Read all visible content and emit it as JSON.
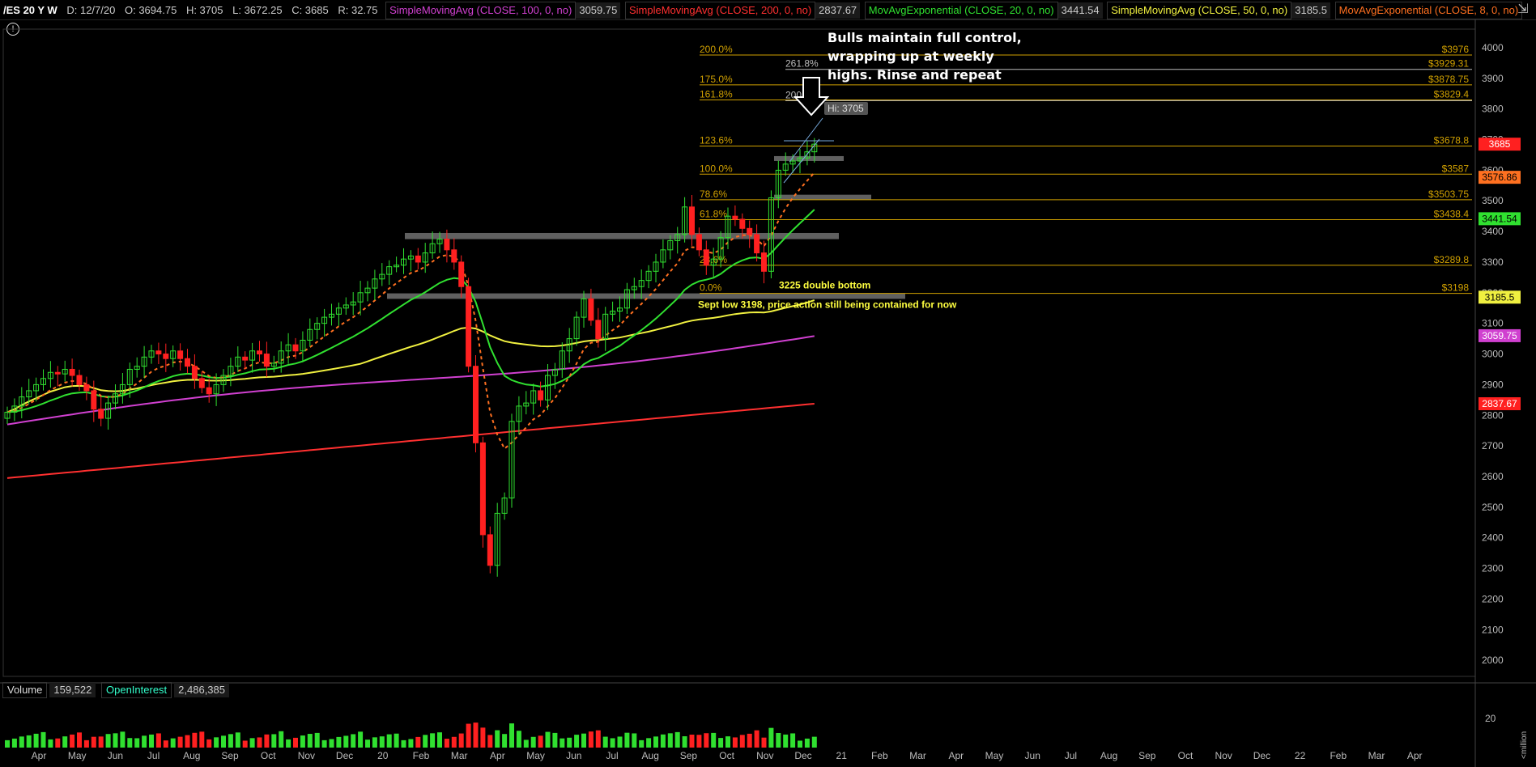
{
  "header": {
    "symbol": "/ES 20 Y W",
    "ohlc": [
      "D: 12/7/20",
      "O: 3694.75",
      "H: 3705",
      "L: 3672.25",
      "C: 3685",
      "R: 32.75"
    ],
    "studies": [
      {
        "label": "SimpleMovingAvg (CLOSE, 100, 0, no)",
        "value": "3059.75",
        "color": "#d040d0"
      },
      {
        "label": "SimpleMovingAvg (CLOSE, 200, 0, no)",
        "value": "2837.67",
        "color": "#ff3030"
      },
      {
        "label": "MovAvgExponential (CLOSE, 20, 0, no)",
        "value": "3441.54",
        "color": "#30e030"
      },
      {
        "label": "SimpleMovingAvg (CLOSE, 50, 0, no)",
        "value": "3185.5",
        "color": "#f0f040"
      },
      {
        "label": "MovAvgExponential (CLOSE, 8, 0, no)",
        "value": "",
        "color": "#ff7020"
      }
    ]
  },
  "icons": {
    "info": "info-icon",
    "collapse": "collapse-icon"
  },
  "volume_header": {
    "volume_label": "Volume",
    "volume_value": "159,522",
    "oi_label": "OpenInterest",
    "oi_value": "2,486,385"
  },
  "colors": {
    "up": "#30e030",
    "down": "#ff2020",
    "fib": "#d0a000",
    "sma50": "#f0f040",
    "sma100": "#d040d0",
    "sma200": "#ff3030",
    "ema20": "#30e030",
    "ema8": "#ff7020",
    "zone": "#808080",
    "annotation": "#ffffff",
    "note": "#ffff40"
  },
  "chart_data": {
    "type": "candlestick",
    "ylim": [
      1900,
      4050
    ],
    "yticks": [
      2000,
      2100,
      2200,
      2300,
      2400,
      2500,
      2600,
      2700,
      2800,
      2900,
      3000,
      3100,
      3200,
      3300,
      3400,
      3500,
      3600,
      3700,
      3800,
      3900,
      4000
    ],
    "xaxis_labels": [
      "Apr",
      "May",
      "Jun",
      "Jul",
      "Aug",
      "Sep",
      "Oct",
      "Nov",
      "Dec",
      "20",
      "Feb",
      "Mar",
      "Apr",
      "May",
      "Jun",
      "Jul",
      "Aug",
      "Sep",
      "Oct",
      "Nov",
      "Dec",
      "21",
      "Feb",
      "Mar",
      "Apr",
      "May",
      "Jun",
      "Jul",
      "Aug",
      "Sep",
      "Oct",
      "Nov",
      "Dec",
      "22",
      "Feb",
      "Mar",
      "Apr"
    ],
    "first_week_index": 0,
    "weekly_closes": [
      2810,
      2830,
      2860,
      2880,
      2900,
      2920,
      2940,
      2935,
      2950,
      2930,
      2900,
      2880,
      2820,
      2790,
      2840,
      2870,
      2900,
      2950,
      2960,
      2990,
      3010,
      3000,
      2985,
      3010,
      2985,
      2960,
      2920,
      2890,
      2870,
      2900,
      2930,
      2960,
      2990,
      2980,
      3010,
      3000,
      2960,
      2970,
      3010,
      3030,
      3010,
      3045,
      3080,
      3100,
      3120,
      3130,
      3150,
      3160,
      3170,
      3200,
      3215,
      3245,
      3260,
      3285,
      3290,
      3310,
      3320,
      3300,
      3330,
      3360,
      3375,
      3340,
      3300,
      3220,
      2960,
      2710,
      2410,
      2310,
      2480,
      2530,
      2780,
      2830,
      2840,
      2880,
      2850,
      2930,
      2950,
      3010,
      3050,
      3120,
      3180,
      3110,
      3050,
      3130,
      3140,
      3150,
      3210,
      3220,
      3240,
      3270,
      3300,
      3340,
      3370,
      3390,
      3480,
      3390,
      3340,
      3290,
      3310,
      3380,
      3450,
      3440,
      3410,
      3390,
      3330,
      3270,
      3510,
      3600,
      3620,
      3630,
      3640,
      3660,
      3685
    ],
    "annotations": [
      {
        "text": "Bulls maintain full control,",
        "kind": "headline"
      },
      {
        "text": "wrapping up at weekly",
        "kind": "headline"
      },
      {
        "text": "highs. Rinse and repeat",
        "kind": "headline"
      },
      {
        "text": "Hi: 3705",
        "kind": "tag"
      },
      {
        "text": "3225 double bottom",
        "kind": "note"
      },
      {
        "text": "Sept low 3198, price action still being contained for now",
        "kind": "note"
      }
    ],
    "fib_levels": [
      {
        "pct": "200.0%",
        "value": 3976,
        "label": "$3976"
      },
      {
        "pct": "261.8%",
        "value": 3929.31,
        "label": "$3929.31"
      },
      {
        "pct": "175.0%",
        "value": 3878.75,
        "label": "$3878.75"
      },
      {
        "pct": "161.8%",
        "value": 3829.4,
        "label": "$3829.4"
      },
      {
        "pct": "200.0%",
        "value": 3827,
        "label": ""
      },
      {
        "pct": "123.6%",
        "value": 3678.8,
        "label": "$3678.8"
      },
      {
        "pct": "100.0%",
        "value": 3587,
        "label": "$3587"
      },
      {
        "pct": "78.6%",
        "value": 3503.75,
        "label": "$3503.75"
      },
      {
        "pct": "61.8%",
        "value": 3438.4,
        "label": "$3438.4"
      },
      {
        "pct": "23.6%",
        "value": 3289.8,
        "label": "$3289.8"
      },
      {
        "pct": "0.0%",
        "value": 3198,
        "label": "$3198"
      }
    ],
    "price_tags": [
      {
        "value": 3685,
        "label": "3685",
        "bg": "#ff2020",
        "fg": "#ffffff"
      },
      {
        "value": 3576.86,
        "label": "3576.86",
        "bg": "#ff7020",
        "fg": "#000000"
      },
      {
        "value": 3441.54,
        "label": "3441.54",
        "bg": "#30e030",
        "fg": "#000000"
      },
      {
        "value": 3185.5,
        "label": "3185.5",
        "bg": "#f0f040",
        "fg": "#000000"
      },
      {
        "value": 3059.75,
        "label": "3059.75",
        "bg": "#d040d0",
        "fg": "#ffffff"
      },
      {
        "value": 2837.67,
        "label": "2837.67",
        "bg": "#ff2020",
        "fg": "#ffffff"
      }
    ],
    "support_zones": [
      {
        "from": 3375,
        "to": 3395
      },
      {
        "from": 3180,
        "to": 3198
      },
      {
        "from": 3507,
        "to": 3520
      },
      {
        "from": 3638,
        "to": 3646
      }
    ],
    "volume_axis_labels": [
      "20",
      "<million"
    ]
  }
}
